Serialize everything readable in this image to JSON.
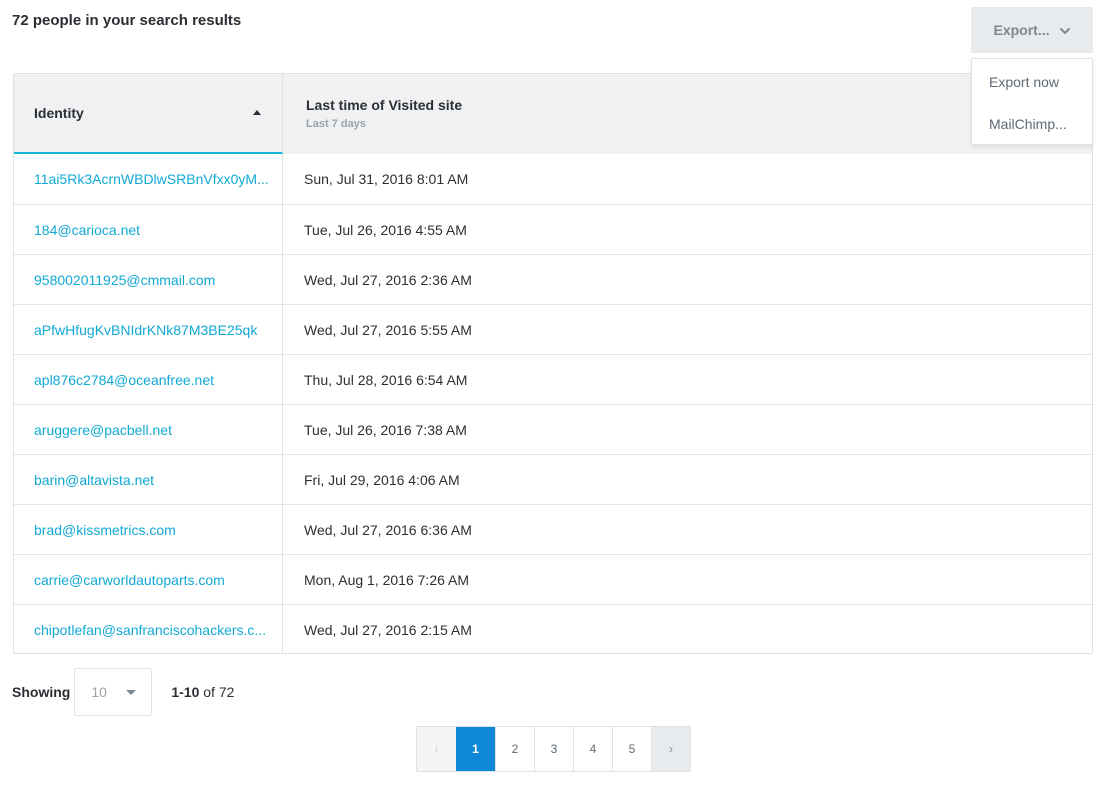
{
  "header": {
    "results_title": "72 people in your search results",
    "export_label": "Export..."
  },
  "export_menu": {
    "items": [
      "Export now",
      "MailChimp..."
    ]
  },
  "table": {
    "columns": {
      "identity": "Identity",
      "visited": "Last time of Visited site",
      "visited_sub": "Last 7 days"
    },
    "sort": "ascending",
    "rows": [
      {
        "identity": "11ai5Rk3AcrnWBDlwSRBnVfxx0yM...",
        "visited": "Sun, Jul 31, 2016 8:01 AM"
      },
      {
        "identity": "184@carioca.net",
        "visited": "Tue, Jul 26, 2016 4:55 AM"
      },
      {
        "identity": "958002011925@cmmail.com",
        "visited": "Wed, Jul 27, 2016 2:36 AM"
      },
      {
        "identity": "aPfwHfugKvBNIdrKNk87M3BE25qk",
        "visited": "Wed, Jul 27, 2016 5:55 AM"
      },
      {
        "identity": "apl876c2784@oceanfree.net",
        "visited": "Thu, Jul 28, 2016 6:54 AM"
      },
      {
        "identity": "aruggere@pacbell.net",
        "visited": "Tue, Jul 26, 2016 7:38 AM"
      },
      {
        "identity": "barin@altavista.net",
        "visited": "Fri, Jul 29, 2016 4:06 AM"
      },
      {
        "identity": "brad@kissmetrics.com",
        "visited": "Wed, Jul 27, 2016 6:36 AM"
      },
      {
        "identity": "carrie@carworldautoparts.com",
        "visited": "Mon, Aug 1, 2016 7:26 AM"
      },
      {
        "identity": "chipotlefan@sanfranciscohackers.c...",
        "visited": "Wed, Jul 27, 2016 2:15 AM"
      }
    ]
  },
  "footer": {
    "showing_label": "Showing",
    "page_size": "10",
    "range_bold": "1-10",
    "range_rest": " of 72"
  },
  "pagination": {
    "prev": "‹",
    "pages": [
      "1",
      "2",
      "3",
      "4",
      "5"
    ],
    "current": "1",
    "next": "›"
  },
  "colors": {
    "accent": "#0f87d8",
    "link": "#11a9d4",
    "sort_underline": "#11b6d9"
  },
  "icons": {
    "export_chevron": "chevron-down-icon",
    "sort": "sort-ascending-icon",
    "page_size_caret": "caret-down-icon"
  }
}
